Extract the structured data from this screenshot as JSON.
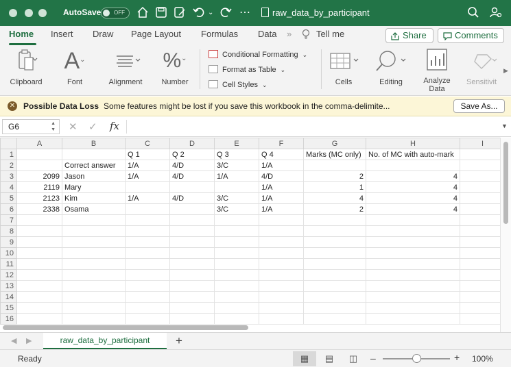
{
  "titlebar": {
    "autosave_label": "AutoSave",
    "autosave_state": "OFF",
    "doc_title": "raw_data_by_participant"
  },
  "tabs": {
    "home": "Home",
    "insert": "Insert",
    "draw": "Draw",
    "page_layout": "Page Layout",
    "formulas": "Formulas",
    "data": "Data",
    "tell_me": "Tell me",
    "share": "Share",
    "comments": "Comments"
  },
  "ribbon": {
    "clipboard": "Clipboard",
    "font": "Font",
    "alignment": "Alignment",
    "number": "Number",
    "conditional_formatting": "Conditional Formatting",
    "format_as_table": "Format as Table",
    "cell_styles": "Cell Styles",
    "cells": "Cells",
    "editing": "Editing",
    "analyze_data_line1": "Analyze",
    "analyze_data_line2": "Data",
    "sensitivity": "Sensitivit"
  },
  "infobar": {
    "title": "Possible Data Loss",
    "message": "Some features might be lost if you save this workbook in the comma-delimite...",
    "button": "Save As..."
  },
  "formula_bar": {
    "name_box": "G6",
    "fx": "fx",
    "value": ""
  },
  "sheet": {
    "columns": [
      "A",
      "B",
      "C",
      "D",
      "E",
      "F",
      "G",
      "H",
      "I"
    ],
    "rows": [
      [
        "",
        "",
        "Q 1",
        "Q 2",
        "Q 3",
        "Q 4",
        "Marks (MC only)",
        "No. of MC with auto-mark",
        ""
      ],
      [
        "",
        "Correct answer",
        "1/A",
        "4/D",
        "3/C",
        "1/A",
        "",
        "",
        ""
      ],
      [
        "2099",
        "Jason",
        "1/A",
        "4/D",
        "1/A",
        "4/D",
        "2",
        "4",
        ""
      ],
      [
        "2119",
        "Mary",
        "",
        "",
        "",
        "1/A",
        "1",
        "4",
        ""
      ],
      [
        "2123",
        "Kim",
        "1/A",
        "4/D",
        "3/C",
        "1/A",
        "4",
        "4",
        ""
      ],
      [
        "2338",
        "Osama",
        "",
        "",
        "3/C",
        "1/A",
        "2",
        "4",
        ""
      ],
      [
        "",
        "",
        "",
        "",
        "",
        "",
        "",
        "",
        ""
      ],
      [
        "",
        "",
        "",
        "",
        "",
        "",
        "",
        "",
        ""
      ],
      [
        "",
        "",
        "",
        "",
        "",
        "",
        "",
        "",
        ""
      ],
      [
        "",
        "",
        "",
        "",
        "",
        "",
        "",
        "",
        ""
      ],
      [
        "",
        "",
        "",
        "",
        "",
        "",
        "",
        "",
        ""
      ],
      [
        "",
        "",
        "",
        "",
        "",
        "",
        "",
        "",
        ""
      ],
      [
        "",
        "",
        "",
        "",
        "",
        "",
        "",
        "",
        ""
      ],
      [
        "",
        "",
        "",
        "",
        "",
        "",
        "",
        "",
        ""
      ],
      [
        "",
        "",
        "",
        "",
        "",
        "",
        "",
        "",
        ""
      ],
      [
        "",
        "",
        "",
        "",
        "",
        "",
        "",
        "",
        ""
      ]
    ],
    "row_numbers": [
      "1",
      "2",
      "3",
      "4",
      "5",
      "6",
      "7",
      "8",
      "9",
      "10",
      "11",
      "12",
      "13",
      "14",
      "15",
      "16"
    ]
  },
  "sheet_tabs": {
    "active": "raw_data_by_participant",
    "add": "+"
  },
  "status": {
    "ready": "Ready",
    "zoom": "100%"
  }
}
